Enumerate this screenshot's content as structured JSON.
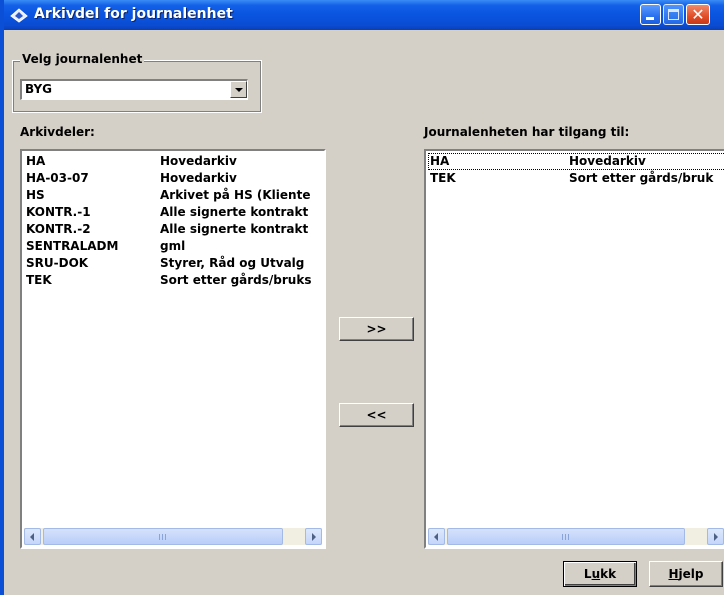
{
  "window": {
    "title": "Arkivdel for journalenhet"
  },
  "journalenhet": {
    "group_label": "Velg journalenhet",
    "selected": "BYG"
  },
  "left_list": {
    "label": "Arkivdeler:",
    "rows": [
      {
        "code": "HA",
        "name": "Hovedarkiv"
      },
      {
        "code": "HA-03-07",
        "name": "Hovedarkiv"
      },
      {
        "code": "HS",
        "name": "Arkivet på HS (Kliente"
      },
      {
        "code": "KONTR.-1",
        "name": "Alle signerte kontrakt"
      },
      {
        "code": "KONTR.-2",
        "name": "Alle signerte kontrakt"
      },
      {
        "code": "SENTRALADM",
        "name": "gml"
      },
      {
        "code": "SRU-DOK",
        "name": "Styrer, Råd og Utvalg"
      },
      {
        "code": "TEK",
        "name": "Sort etter gårds/bruks"
      }
    ]
  },
  "right_list": {
    "label": "Journalenheten har tilgang til:",
    "rows": [
      {
        "code": "HA",
        "name": "Hovedarkiv"
      },
      {
        "code": "TEK",
        "name": "Sort etter gårds/bruk"
      }
    ]
  },
  "buttons": {
    "add": ">>",
    "remove": "<<",
    "close_prefix": "L",
    "close_mnemonic": "u",
    "close_suffix": "kk",
    "help_mnemonic": "H",
    "help_suffix": "jelp"
  }
}
